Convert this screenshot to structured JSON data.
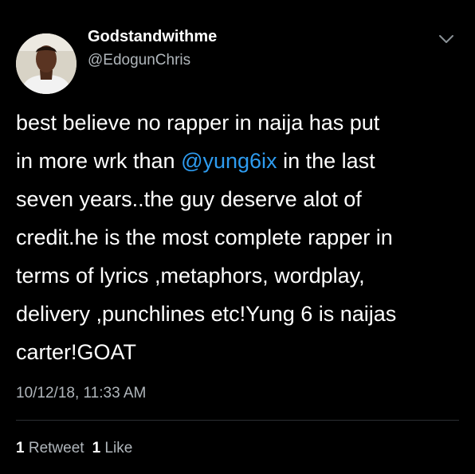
{
  "author": {
    "display_name": "Godstandwithme",
    "handle": "@EdogunChris"
  },
  "tweet": {
    "lines": [
      "best believe no rapper  in naija has put",
      "in more wrk than ",
      "seven years..the guy deserve alot of",
      "credit.he is the most complete rapper in",
      "terms of lyrics ,metaphors, wordplay,",
      "delivery ,punchlines etc!Yung 6 is naijas",
      "carter!GOAT"
    ],
    "mention": "@yung6ix",
    "line2_suffix": " in the last",
    "timestamp": "10/12/18, 11:33 AM"
  },
  "stats": {
    "retweets_count": "1",
    "retweets_label": "Retweet",
    "likes_count": "1",
    "likes_label": "Like"
  },
  "colors": {
    "background": "#000000",
    "text": "#ffffff",
    "secondary": "#b0b6bb",
    "mention": "#2e9cf0"
  },
  "icons": {
    "menu": "chevron-down-icon"
  }
}
